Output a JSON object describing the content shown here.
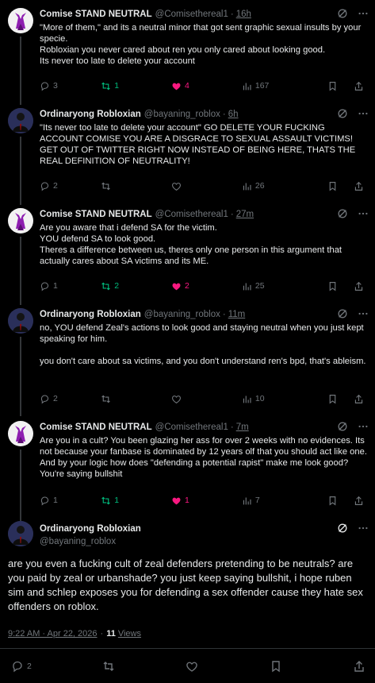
{
  "colors": {
    "background": "#000000",
    "text": "#e7e9ea",
    "muted": "#71767b",
    "retweet_active": "#00ba7c",
    "like_active": "#f91880",
    "divider": "#2f3336"
  },
  "tweets": [
    {
      "name": "Comise STAND NEUTRAL",
      "handle": "@Comisethereal1",
      "sep": "·",
      "time": "16h",
      "body": "\"More of them,\" and its a neutral minor that got sent graphic sexual insults by your specie.\nRobloxian you never cared about ren you only cared about looking good.\nIts never too late to delete your account",
      "replies": "3",
      "retweets": "1",
      "likes": "4",
      "views": "167",
      "retweeted": true,
      "liked": true,
      "avatar_icon": "purple-horns-avatar-icon"
    },
    {
      "name": "Ordinaryong Robloxian",
      "handle": "@bayaning_roblox",
      "sep": "·",
      "time": "6h",
      "body": "\"Its never too late to delete your account\" GO DELETE YOUR FUCKING ACCOUNT COMISE YOU ARE A DISGRACE TO SEXUAL ASSAULT VICTIMS! GET OUT OF TWITTER RIGHT NOW INSTEAD OF BEING HERE, THATS THE REAL DEFINITION OF NEUTRALITY!",
      "replies": "2",
      "retweets": "",
      "likes": "",
      "views": "26",
      "retweeted": false,
      "liked": false,
      "avatar_icon": "suit-figure-avatar-icon"
    },
    {
      "name": "Comise STAND NEUTRAL",
      "handle": "@Comisethereal1",
      "sep": "·",
      "time": "27m",
      "body": "Are you aware that i defend SA for the victim.\nYOU defend SA to look good.\nTheres a difference between us, theres only one person in this argument that actually cares about SA victims and its ME.",
      "replies": "1",
      "retweets": "2",
      "likes": "2",
      "views": "25",
      "retweeted": true,
      "liked": true,
      "avatar_icon": "purple-horns-avatar-icon"
    },
    {
      "name": "Ordinaryong Robloxian",
      "handle": "@bayaning_roblox",
      "sep": "·",
      "time": "11m",
      "body": "no, YOU defend Zeal's actions to look good and staying neutral when you just kept speaking for him.\n\nyou don't care about sa victims, and you don't understand ren's bpd, that's ableism.",
      "replies": "2",
      "retweets": "",
      "likes": "",
      "views": "10",
      "retweeted": false,
      "liked": false,
      "avatar_icon": "suit-figure-avatar-icon"
    },
    {
      "name": "Comise STAND NEUTRAL",
      "handle": "@Comisethereal1",
      "sep": "·",
      "time": "7m",
      "body": "Are you in a cult? You been glazing her ass for over 2 weeks with no evidences. Its not because your fanbase is dominated by 12 years olf that you should act like one. And by your logic how does \"defending a potential rapist\" make me look good? You're saying bullshit",
      "replies": "1",
      "retweets": "1",
      "likes": "1",
      "views": "7",
      "retweeted": true,
      "liked": true,
      "avatar_icon": "purple-horns-avatar-icon"
    }
  ],
  "main": {
    "name": "Ordinaryong Robloxian",
    "handle": "@bayaning_roblox",
    "body": "are you even a fucking cult of zeal defenders pretending to be neutrals? are you paid by zeal or urbanshade? you just keep saying bullshit, i hope ruben sim and schlep exposes you for defending a sex offender cause they hate sex offenders on roblox.",
    "timestamp": "9:22 AM · Apr 22, 2026",
    "sep": "·",
    "views_count": "11",
    "views_label": "Views",
    "replies": "2"
  }
}
